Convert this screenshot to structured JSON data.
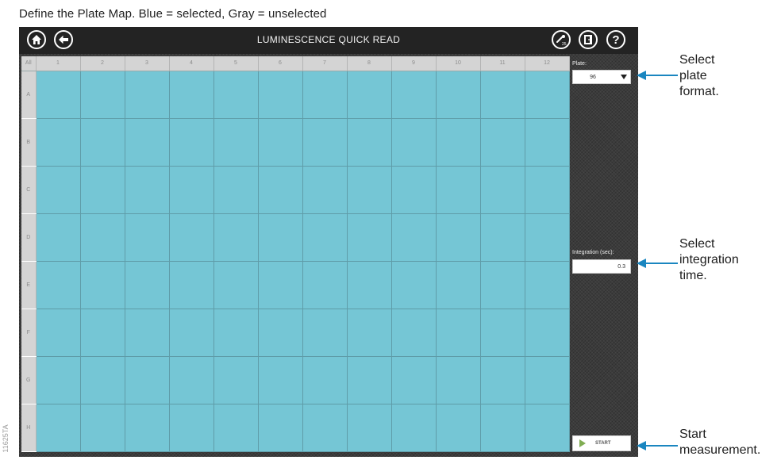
{
  "caption": "Define the Plate Map. Blue = selected, Gray = unselected",
  "figure_id": "11625TA",
  "app": {
    "title": "LUMINESCENCE QUICK READ",
    "toolbar_left": [
      {
        "name": "home-icon"
      },
      {
        "name": "back-arrow-icon"
      }
    ],
    "toolbar_right": [
      {
        "name": "temperature-icon",
        "label": "25"
      },
      {
        "name": "door-icon"
      },
      {
        "name": "help-icon",
        "label": "?"
      }
    ]
  },
  "plate_map": {
    "corner_label": "All",
    "columns": [
      "1",
      "2",
      "3",
      "4",
      "5",
      "6",
      "7",
      "8",
      "9",
      "10",
      "11",
      "12"
    ],
    "rows": [
      "A",
      "B",
      "C",
      "D",
      "E",
      "F",
      "G",
      "H"
    ],
    "well_state": "selected",
    "selected_color": "#75c6d5"
  },
  "side_panel": {
    "plate_label": "Plate:",
    "plate_value": "96",
    "integration_label": "Integration (sec):",
    "integration_value": "0.3",
    "start_label": "START"
  },
  "annotations": {
    "plate": [
      "Select",
      "plate",
      "format."
    ],
    "integration": [
      "Select",
      "integration",
      "time."
    ],
    "start": [
      "Start",
      "measurement."
    ],
    "arrow_color": "#1a86c0"
  }
}
